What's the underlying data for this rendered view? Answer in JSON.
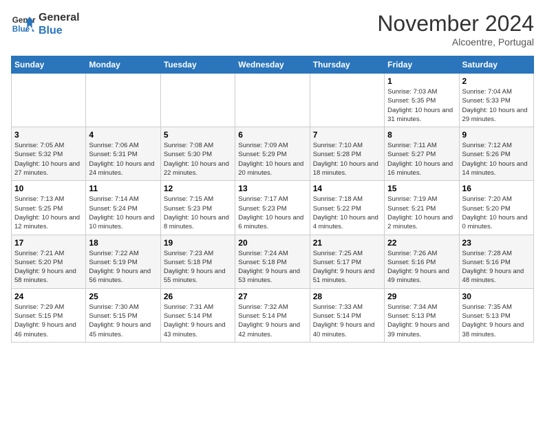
{
  "header": {
    "logo_line1": "General",
    "logo_line2": "Blue",
    "month": "November 2024",
    "location": "Alcoentre, Portugal"
  },
  "weekdays": [
    "Sunday",
    "Monday",
    "Tuesday",
    "Wednesday",
    "Thursday",
    "Friday",
    "Saturday"
  ],
  "weeks": [
    [
      {
        "day": "",
        "info": ""
      },
      {
        "day": "",
        "info": ""
      },
      {
        "day": "",
        "info": ""
      },
      {
        "day": "",
        "info": ""
      },
      {
        "day": "",
        "info": ""
      },
      {
        "day": "1",
        "info": "Sunrise: 7:03 AM\nSunset: 5:35 PM\nDaylight: 10 hours and 31 minutes."
      },
      {
        "day": "2",
        "info": "Sunrise: 7:04 AM\nSunset: 5:33 PM\nDaylight: 10 hours and 29 minutes."
      }
    ],
    [
      {
        "day": "3",
        "info": "Sunrise: 7:05 AM\nSunset: 5:32 PM\nDaylight: 10 hours and 27 minutes."
      },
      {
        "day": "4",
        "info": "Sunrise: 7:06 AM\nSunset: 5:31 PM\nDaylight: 10 hours and 24 minutes."
      },
      {
        "day": "5",
        "info": "Sunrise: 7:08 AM\nSunset: 5:30 PM\nDaylight: 10 hours and 22 minutes."
      },
      {
        "day": "6",
        "info": "Sunrise: 7:09 AM\nSunset: 5:29 PM\nDaylight: 10 hours and 20 minutes."
      },
      {
        "day": "7",
        "info": "Sunrise: 7:10 AM\nSunset: 5:28 PM\nDaylight: 10 hours and 18 minutes."
      },
      {
        "day": "8",
        "info": "Sunrise: 7:11 AM\nSunset: 5:27 PM\nDaylight: 10 hours and 16 minutes."
      },
      {
        "day": "9",
        "info": "Sunrise: 7:12 AM\nSunset: 5:26 PM\nDaylight: 10 hours and 14 minutes."
      }
    ],
    [
      {
        "day": "10",
        "info": "Sunrise: 7:13 AM\nSunset: 5:25 PM\nDaylight: 10 hours and 12 minutes."
      },
      {
        "day": "11",
        "info": "Sunrise: 7:14 AM\nSunset: 5:24 PM\nDaylight: 10 hours and 10 minutes."
      },
      {
        "day": "12",
        "info": "Sunrise: 7:15 AM\nSunset: 5:23 PM\nDaylight: 10 hours and 8 minutes."
      },
      {
        "day": "13",
        "info": "Sunrise: 7:17 AM\nSunset: 5:23 PM\nDaylight: 10 hours and 6 minutes."
      },
      {
        "day": "14",
        "info": "Sunrise: 7:18 AM\nSunset: 5:22 PM\nDaylight: 10 hours and 4 minutes."
      },
      {
        "day": "15",
        "info": "Sunrise: 7:19 AM\nSunset: 5:21 PM\nDaylight: 10 hours and 2 minutes."
      },
      {
        "day": "16",
        "info": "Sunrise: 7:20 AM\nSunset: 5:20 PM\nDaylight: 10 hours and 0 minutes."
      }
    ],
    [
      {
        "day": "17",
        "info": "Sunrise: 7:21 AM\nSunset: 5:20 PM\nDaylight: 9 hours and 58 minutes."
      },
      {
        "day": "18",
        "info": "Sunrise: 7:22 AM\nSunset: 5:19 PM\nDaylight: 9 hours and 56 minutes."
      },
      {
        "day": "19",
        "info": "Sunrise: 7:23 AM\nSunset: 5:18 PM\nDaylight: 9 hours and 55 minutes."
      },
      {
        "day": "20",
        "info": "Sunrise: 7:24 AM\nSunset: 5:18 PM\nDaylight: 9 hours and 53 minutes."
      },
      {
        "day": "21",
        "info": "Sunrise: 7:25 AM\nSunset: 5:17 PM\nDaylight: 9 hours and 51 minutes."
      },
      {
        "day": "22",
        "info": "Sunrise: 7:26 AM\nSunset: 5:16 PM\nDaylight: 9 hours and 49 minutes."
      },
      {
        "day": "23",
        "info": "Sunrise: 7:28 AM\nSunset: 5:16 PM\nDaylight: 9 hours and 48 minutes."
      }
    ],
    [
      {
        "day": "24",
        "info": "Sunrise: 7:29 AM\nSunset: 5:15 PM\nDaylight: 9 hours and 46 minutes."
      },
      {
        "day": "25",
        "info": "Sunrise: 7:30 AM\nSunset: 5:15 PM\nDaylight: 9 hours and 45 minutes."
      },
      {
        "day": "26",
        "info": "Sunrise: 7:31 AM\nSunset: 5:14 PM\nDaylight: 9 hours and 43 minutes."
      },
      {
        "day": "27",
        "info": "Sunrise: 7:32 AM\nSunset: 5:14 PM\nDaylight: 9 hours and 42 minutes."
      },
      {
        "day": "28",
        "info": "Sunrise: 7:33 AM\nSunset: 5:14 PM\nDaylight: 9 hours and 40 minutes."
      },
      {
        "day": "29",
        "info": "Sunrise: 7:34 AM\nSunset: 5:13 PM\nDaylight: 9 hours and 39 minutes."
      },
      {
        "day": "30",
        "info": "Sunrise: 7:35 AM\nSunset: 5:13 PM\nDaylight: 9 hours and 38 minutes."
      }
    ]
  ]
}
